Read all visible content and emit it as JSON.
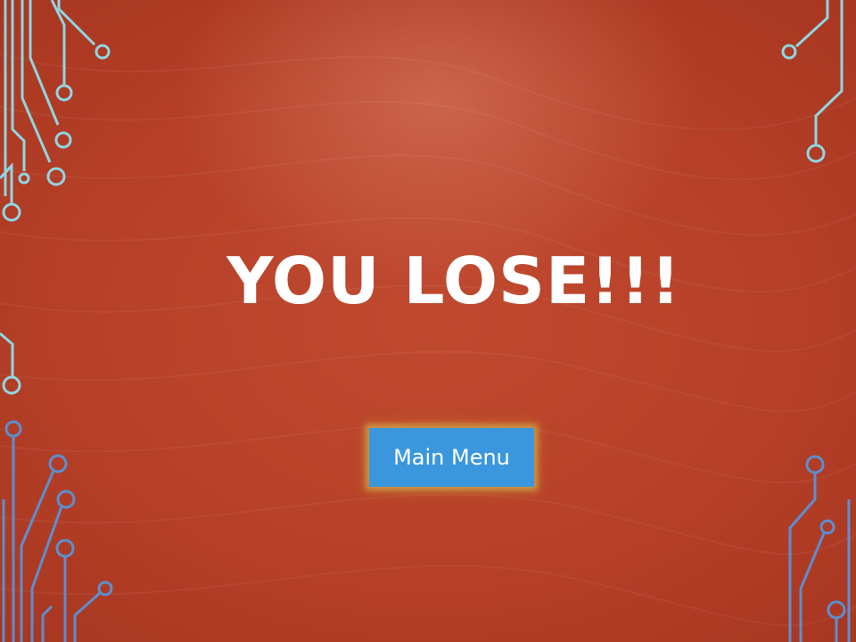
{
  "screen": {
    "title": "YOU LOSE!!!",
    "main_menu_label": "Main Menu"
  },
  "colors": {
    "background": "#b74028",
    "title_text": "#ffffff",
    "button_background": "#3a97dd",
    "button_glow": "#d2aa46",
    "circuit_teal": "#8fd6e3",
    "circuit_blue": "#5b8fd0"
  },
  "decorations": {
    "corner_art": "circuit-lines-icon"
  }
}
